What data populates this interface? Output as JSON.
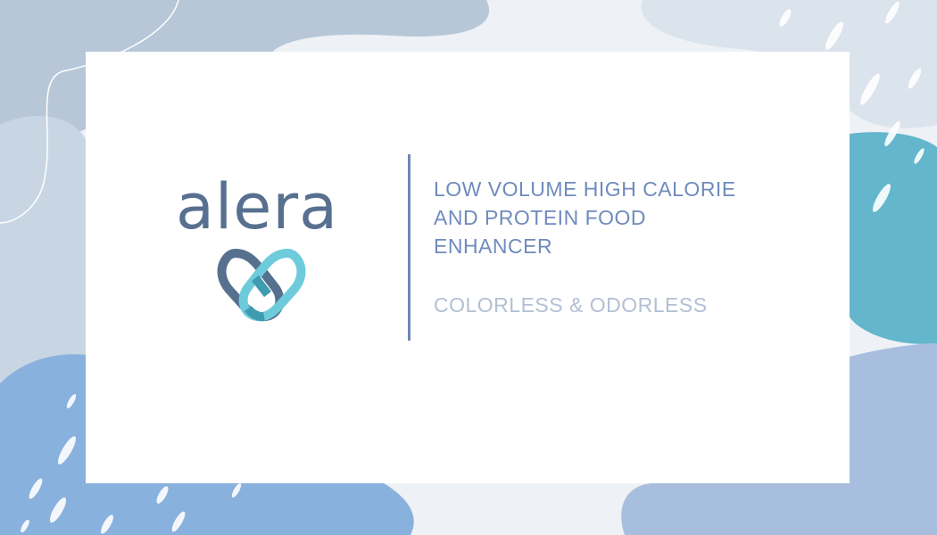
{
  "brand": {
    "name": "alera",
    "logo_icon": "interlocking-heart-icon"
  },
  "headline": {
    "line1": "LOW VOLUME HIGH CALORIE",
    "line2": "AND PROTEIN FOOD",
    "line3": "ENHANCER"
  },
  "subline": "COLORLESS & ODORLESS",
  "colors": {
    "page_background": "#eef1f5",
    "card_background": "#ffffff",
    "wordmark": "#58708f",
    "headline": "#6f8bbd",
    "subline": "#b3c0d3",
    "divider": "#6f87b5",
    "logo_dark": "#56708e",
    "logo_light": "#6dcbdb",
    "logo_overlap": "#3f9bb0",
    "blob_grey_blue": "#b8c7d8",
    "blob_teal": "#63b6cb",
    "blob_mid_blue": "#89b1dd",
    "blob_periwinkle": "#a8bede"
  }
}
